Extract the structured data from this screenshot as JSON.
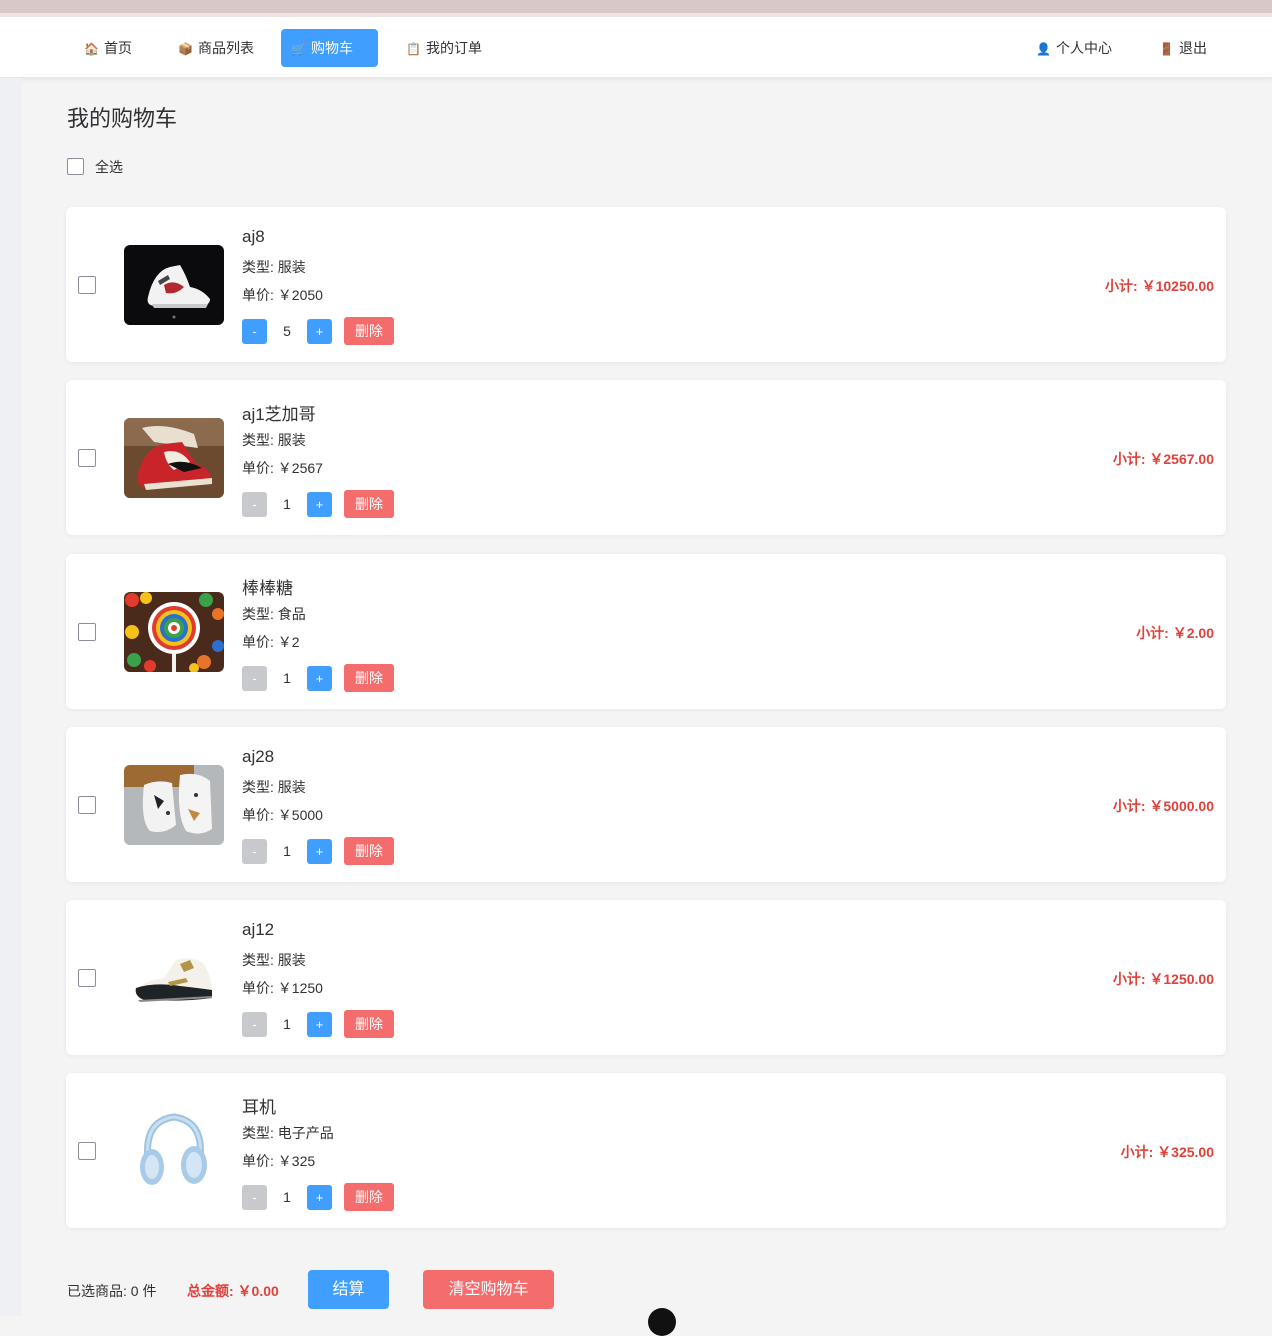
{
  "nav": {
    "home": {
      "icon": "🏠",
      "icon_name": "house-icon",
      "label": "首页"
    },
    "products": {
      "icon": "📦",
      "icon_name": "package-icon",
      "label": "商品列表"
    },
    "cart": {
      "icon": "🛒",
      "icon_name": "cart-icon",
      "label": "购物车"
    },
    "orders": {
      "icon": "📋",
      "icon_name": "clipboard-icon",
      "label": "我的订单"
    },
    "profile": {
      "icon": "👤",
      "icon_name": "user-icon",
      "label": "个人中心"
    },
    "logout": {
      "icon": "🚪",
      "icon_name": "door-icon",
      "label": "退出"
    }
  },
  "page": {
    "title": "我的购物车",
    "select_all_label": "全选"
  },
  "items": [
    {
      "name": "aj8",
      "type": "类型: 服装",
      "price": "单价: ￥2050",
      "quantity": "5",
      "minus": "-",
      "plus": "+",
      "delete": "删除",
      "subtotal": "小计: ￥10250.00",
      "image_name": "sneaker-image"
    },
    {
      "name": "aj1芝加哥",
      "type": "类型: 服装",
      "price": "单价: ￥2567",
      "quantity": "1",
      "minus": "-",
      "plus": "+",
      "delete": "删除",
      "subtotal": "小计: ￥2567.00",
      "image_name": "sneaker-image"
    },
    {
      "name": "棒棒糖",
      "type": "类型: 食品",
      "price": "单价: ￥2",
      "quantity": "1",
      "minus": "-",
      "plus": "+",
      "delete": "删除",
      "subtotal": "小计: ￥2.00",
      "image_name": "lollipop-image"
    },
    {
      "name": "aj28",
      "type": "类型: 服装",
      "price": "单价: ￥5000",
      "quantity": "1",
      "minus": "-",
      "plus": "+",
      "delete": "删除",
      "subtotal": "小计: ￥5000.00",
      "image_name": "sneaker-image"
    },
    {
      "name": "aj12",
      "type": "类型: 服装",
      "price": "单价: ￥1250",
      "quantity": "1",
      "minus": "-",
      "plus": "+",
      "delete": "删除",
      "subtotal": "小计: ￥1250.00",
      "image_name": "sneaker-image"
    },
    {
      "name": "耳机",
      "type": "类型: 电子产品",
      "price": "单价: ￥325",
      "quantity": "1",
      "minus": "-",
      "plus": "+",
      "delete": "删除",
      "subtotal": "小计: ￥325.00",
      "image_name": "headphones-image"
    }
  ],
  "footer": {
    "selected_count": "已选商品: 0 件",
    "total": "总金额: ￥0.00",
    "checkout_label": "结算",
    "clear_label": "清空购物车"
  },
  "colors": {
    "primary": "#409eff",
    "danger": "#f56c6c",
    "price_red": "#e0413a",
    "disabled": "#c8c9cc"
  }
}
